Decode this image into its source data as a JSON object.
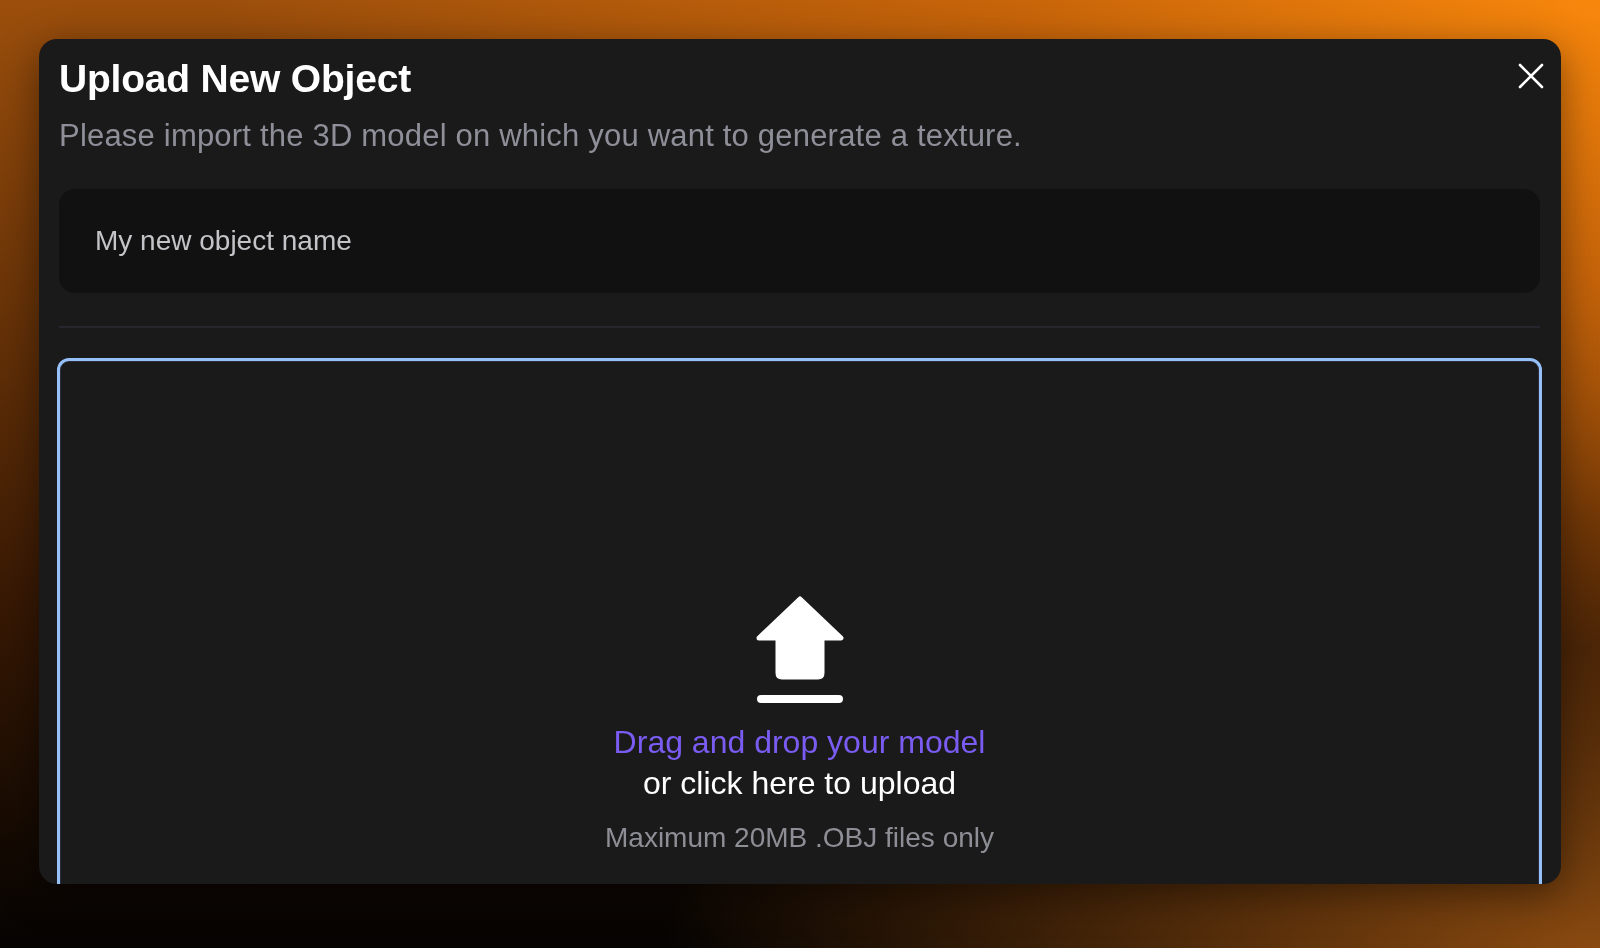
{
  "dialog": {
    "title": "Upload New Object",
    "subtitle": "Please import the 3D model on which you want to generate a texture.",
    "name_field": {
      "placeholder": "My new object name"
    },
    "dropzone": {
      "active": true,
      "primary_text": "Drag and drop your model",
      "secondary_text": "or click here to upload",
      "hint": "Maximum 20MB .OBJ files only"
    }
  }
}
